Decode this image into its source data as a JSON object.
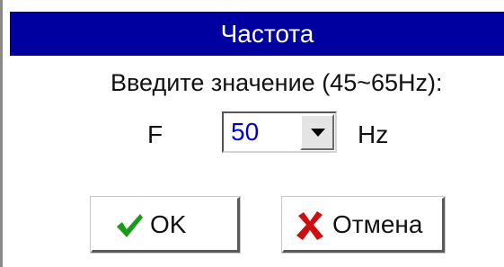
{
  "dialog": {
    "title": "Частота",
    "prompt": "Введите значение (45~65Hz):",
    "field_label": "F",
    "frequency_value": "50",
    "unit": "Hz",
    "ok_label": "OK",
    "cancel_label": "Отмена"
  },
  "icons": {
    "ok": "checkmark-icon",
    "cancel": "cross-icon",
    "dropdown": "chevron-down-icon"
  },
  "colors": {
    "title_bar": "#0000a0",
    "value_text": "#0000cc",
    "check": "#1a9a1a",
    "cross": "#cc1010"
  }
}
